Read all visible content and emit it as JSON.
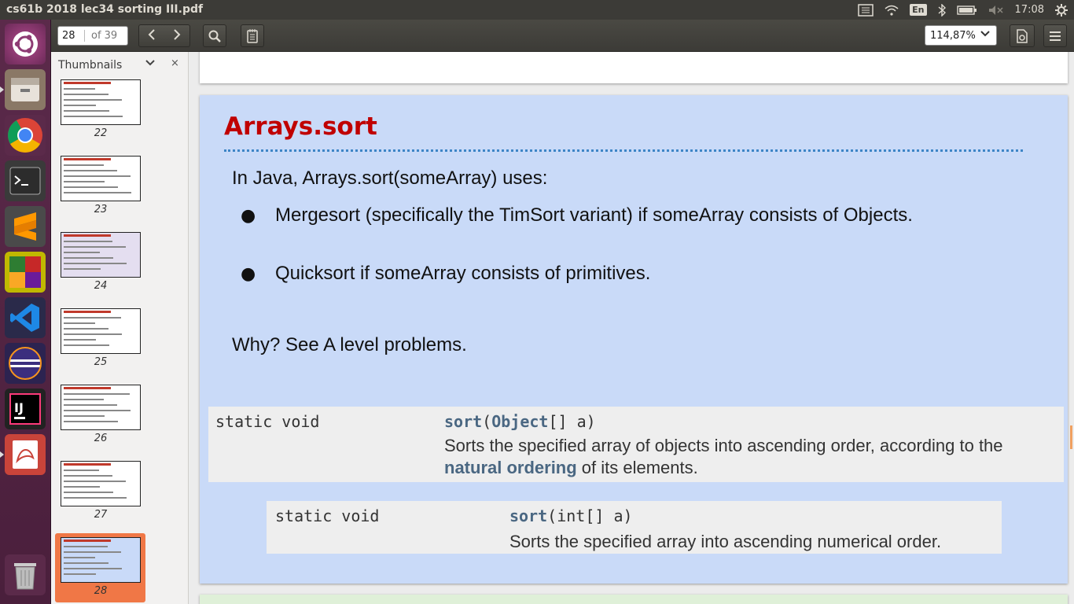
{
  "window": {
    "title": "cs61b 2018 lec34 sorting III.pdf"
  },
  "tray": {
    "lang": "En",
    "time": "17:08"
  },
  "launcher": {
    "items": [
      "ubuntu-dash",
      "files",
      "chrome",
      "terminal",
      "sublime-text",
      "libreoffice",
      "vscode",
      "eclipse",
      "intellij",
      "document-viewer",
      "trash"
    ]
  },
  "toolbar": {
    "page_current": "28",
    "page_total": "of 39",
    "zoom": "114,87%"
  },
  "sidebar": {
    "header": "Thumbnails",
    "close": "×",
    "thumbnails": [
      {
        "num": "22",
        "bg": "#ffffff"
      },
      {
        "num": "23",
        "bg": "#ffffff"
      },
      {
        "num": "24",
        "bg": "#e4def0"
      },
      {
        "num": "25",
        "bg": "#ffffff"
      },
      {
        "num": "26",
        "bg": "#ffffff"
      },
      {
        "num": "27",
        "bg": "#ffffff"
      },
      {
        "num": "28",
        "bg": "#c9daf8"
      }
    ],
    "selected_accent": "#f07746"
  },
  "slide": {
    "title": "Arrays.sort",
    "intro": "In Java, Arrays.sort(someArray) uses:",
    "bullets": [
      "Mergesort (specifically the TimSort variant) if someArray consists of Objects.",
      "Quicksort if someArray consists of primitives."
    ],
    "bullet_symbol": "●",
    "why": "Why? See A level problems.",
    "api1": {
      "modifier": "static void",
      "method": "sort",
      "paren_open": "(",
      "param_type": "Object",
      "param_rest": "[] a)",
      "desc_line1": "Sorts the specified array of objects into ascending order, according to the",
      "desc_link": "natural ordering",
      "desc_line2_rest": " of its elements."
    },
    "api2": {
      "modifier": "static void",
      "method": "sort",
      "params": "(int[] a)",
      "desc": "Sorts the specified array into ascending numerical order."
    },
    "colors": {
      "background": "#c9daf8",
      "title": "#c00000",
      "rule": "#3d85c6"
    }
  }
}
